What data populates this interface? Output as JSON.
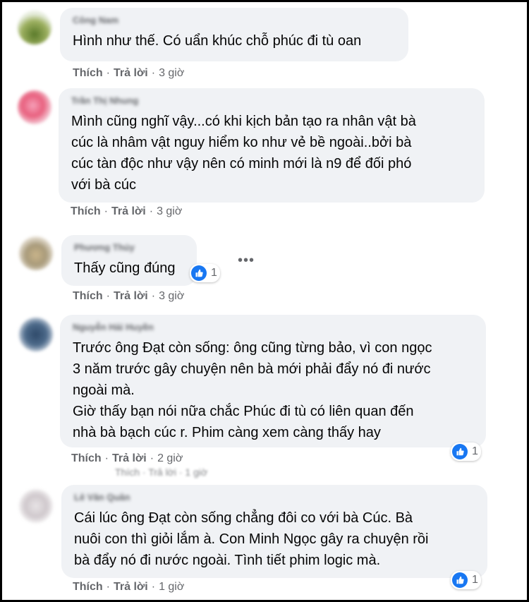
{
  "actions": {
    "like_label": "Thích",
    "reply_label": "Trả lời",
    "separator": "·"
  },
  "comments": [
    {
      "author": "Công Nam",
      "text": "Hình như thế. Có uẩn khúc chỗ phúc đi tù oan",
      "time": "3 giờ",
      "reactions": ""
    },
    {
      "author": "Trần Thị Nhung",
      "text": "Mình cũng nghĩ vậy...có khi kịch bản tạo ra nhân vật bà\ncúc là nhâm vật nguy hiểm ko như vẻ bề ngoài..bởi bà\ncúc tàn độc như vậy nên có minh mới là n9 để đối phó\nvới bà cúc",
      "time": "3 giờ",
      "reactions": ""
    },
    {
      "author": "Phương Thúy",
      "text": "Thấy cũng đúng",
      "time": "3 giờ",
      "reactions": "1"
    },
    {
      "author": "Nguyễn Hải Huyền",
      "text": "Trước ông Đạt còn sống: ông cũng từng bảo, vì con ngọc\n3 năm trước gây chuyện nên bà mới phải đẩy nó đi nước\nngoài mà.\nGiờ thấy bạn nói nữa chắc Phúc đi tù có liên quan đến\nnhà bà bạch cúc r. Phim càng xem càng thấy hay",
      "time": "2 giờ",
      "reactions": "1"
    },
    {
      "author": "Lê Văn Quân",
      "text": "Cái lúc ông Đạt còn sống chẳng đôi co với bà Cúc. Bà\nnuôi con thì giỏi lắm à. Con Minh Ngọc gây ra chuyện rồi\nbà đẩy nó đi nước ngoài. Tình tiết phim logic mà.",
      "time": "1 giờ",
      "reactions": "1"
    }
  ],
  "ghost_actions": "Thích · Trả lời · 1 giờ",
  "more_icon": "ellipsis-icon",
  "colors": {
    "bubble": "#f0f2f5",
    "like_blue": "#1877f2",
    "meta": "#65676b"
  }
}
